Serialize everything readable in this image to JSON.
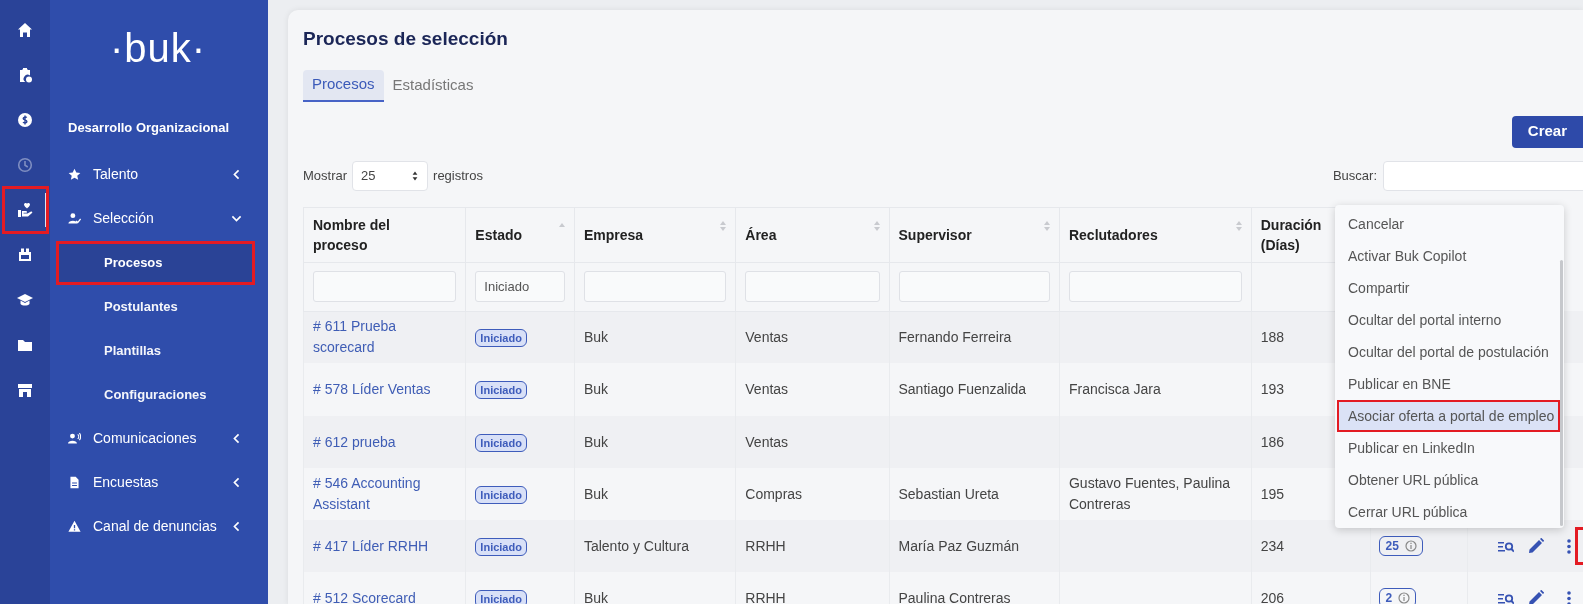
{
  "rail": [
    {
      "selected": false,
      "disabled": false,
      "annotated": false
    },
    {
      "selected": false,
      "disabled": false,
      "annotated": false
    },
    {
      "selected": false,
      "disabled": false,
      "annotated": false
    },
    {
      "selected": false,
      "disabled": true,
      "annotated": false
    },
    {
      "selected": true,
      "disabled": false,
      "annotated": true
    },
    {
      "selected": false,
      "disabled": false,
      "annotated": false
    },
    {
      "selected": false,
      "disabled": false,
      "annotated": false
    },
    {
      "selected": false,
      "disabled": false,
      "annotated": false
    },
    {
      "selected": false,
      "disabled": false,
      "annotated": false
    }
  ],
  "logo": "·buk·",
  "sidebar": {
    "section": "Desarrollo Organizacional",
    "items": [
      {
        "label": "Talento",
        "expanded": false
      },
      {
        "label": "Selección",
        "expanded": true,
        "children": [
          {
            "label": "Procesos",
            "selected": true,
            "annotated": true
          },
          {
            "label": "Postulantes",
            "selected": false,
            "annotated": false
          },
          {
            "label": "Plantillas",
            "selected": false,
            "annotated": false
          },
          {
            "label": "Configuraciones",
            "selected": false,
            "annotated": false
          }
        ]
      },
      {
        "label": "Comunicaciones",
        "expanded": false
      },
      {
        "label": "Encuestas",
        "expanded": false
      },
      {
        "label": "Canal de denuncias",
        "expanded": false
      }
    ]
  },
  "page": {
    "title": "Procesos de selección",
    "tabs": [
      {
        "label": "Procesos",
        "selected": true
      },
      {
        "label": "Estadísticas",
        "selected": false
      }
    ],
    "create_button": "Crear",
    "show_label": "Mostrar",
    "show_value": "25",
    "records_label": "registros",
    "search_label": "Buscar:"
  },
  "table": {
    "columns": [
      {
        "label": "Nombre del proceso"
      },
      {
        "label": "Estado"
      },
      {
        "label": "Empresa"
      },
      {
        "label": "Área"
      },
      {
        "label": "Supervisor"
      },
      {
        "label": "Reclutadores"
      },
      {
        "label": "Duración (Días)"
      }
    ],
    "filters": [
      {
        "kind": "input"
      },
      {
        "kind": "input",
        "value": "Iniciado"
      },
      {
        "kind": "input"
      },
      {
        "kind": "input"
      },
      {
        "kind": "input"
      },
      {
        "kind": "input"
      },
      {
        "kind": "none"
      }
    ],
    "rows": [
      {
        "name": "# 611 Prueba scorecard",
        "status": "Iniciado",
        "company": "Buk",
        "area": "Ventas",
        "supervisor": "Fernando Ferreira",
        "recruiters": "",
        "duration": "188",
        "actions_visible": false
      },
      {
        "name": "# 578 Líder Ventas",
        "status": "Iniciado",
        "company": "Buk",
        "area": "Ventas",
        "supervisor": "Santiago Fuenzalida",
        "recruiters": "Francisca Jara",
        "duration": "193",
        "actions_visible": false
      },
      {
        "name": "# 612 prueba",
        "status": "Iniciado",
        "company": "Buk",
        "area": "Ventas",
        "supervisor": "",
        "recruiters": "",
        "duration": "186",
        "actions_visible": false
      },
      {
        "name": "# 546 Accounting Assistant",
        "status": "Iniciado",
        "company": "Buk",
        "area": "Compras",
        "supervisor": "Sebastian Ureta",
        "recruiters": "Gustavo Fuentes, Paulina Contreras",
        "duration": "195",
        "actions_visible": false
      },
      {
        "name": "# 417 Líder RRHH",
        "status": "Iniciado",
        "company": "Talento y Cultura",
        "area": "RRHH",
        "supervisor": "María Paz Guzmán",
        "recruiters": "",
        "duration": "234",
        "count": "25",
        "actions_visible": true,
        "more_annotated": true
      },
      {
        "name": "# 512 Scorecard",
        "status": "Iniciado",
        "company": "Buk",
        "area": "RRHH",
        "supervisor": "Paulina Contreras",
        "recruiters": "",
        "duration": "206",
        "count": "2",
        "actions_visible": true,
        "more_annotated": false
      }
    ]
  },
  "menu": {
    "items": [
      {
        "label": "Cancelar",
        "selected": false,
        "annotated": false
      },
      {
        "label": "Activar Buk Copilot",
        "selected": false,
        "annotated": false
      },
      {
        "label": "Compartir",
        "selected": false,
        "annotated": false
      },
      {
        "label": "Ocultar del portal interno",
        "selected": false,
        "annotated": false
      },
      {
        "label": "Ocultar del portal de postulación",
        "selected": false,
        "annotated": false
      },
      {
        "label": "Publicar en BNE",
        "selected": false,
        "annotated": false
      },
      {
        "label": "Asociar oferta a portal de empleo",
        "selected": true,
        "annotated": true
      },
      {
        "label": "Publicar en LinkedIn",
        "selected": false,
        "annotated": false
      },
      {
        "label": "Obtener URL pública",
        "selected": false,
        "annotated": false
      },
      {
        "label": "Cerrar URL pública",
        "selected": false,
        "annotated": false
      }
    ]
  }
}
